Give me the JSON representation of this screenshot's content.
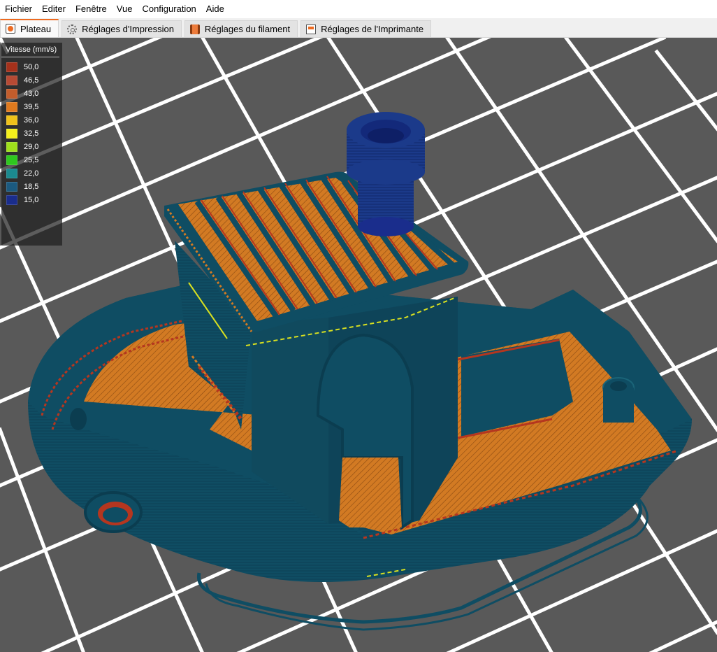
{
  "menu": [
    "Fichier",
    "Editer",
    "Fenêtre",
    "Vue",
    "Configuration",
    "Aide"
  ],
  "tabs": [
    {
      "label": "Plateau",
      "icon": "plater-icon",
      "active": true
    },
    {
      "label": "Réglages d'Impression",
      "icon": "gear-icon",
      "active": false
    },
    {
      "label": "Réglages du filament",
      "icon": "filament-icon",
      "active": false
    },
    {
      "label": "Réglages de l'Imprimante",
      "icon": "printer-icon",
      "active": false
    }
  ],
  "legend": {
    "title": "Vitesse (mm/s)",
    "items": [
      {
        "value": "50,0",
        "color": "#a5311b"
      },
      {
        "value": "46,5",
        "color": "#b74a34"
      },
      {
        "value": "43,0",
        "color": "#c35d2c"
      },
      {
        "value": "39,5",
        "color": "#e07a1e"
      },
      {
        "value": "36,0",
        "color": "#f0c21a"
      },
      {
        "value": "32,5",
        "color": "#f5f01c"
      },
      {
        "value": "29,0",
        "color": "#9fe01c"
      },
      {
        "value": "25,5",
        "color": "#2ec81e"
      },
      {
        "value": "22,0",
        "color": "#1b8a8f"
      },
      {
        "value": "18,5",
        "color": "#1b5a80"
      },
      {
        "value": "15,0",
        "color": "#1a2d8c"
      }
    ]
  },
  "colors": {
    "accent": "#ed6b21",
    "bed": "#595959",
    "grid": "#ffffff",
    "model_perimeter": "#0f4d63",
    "model_infill": "#d27a23"
  }
}
